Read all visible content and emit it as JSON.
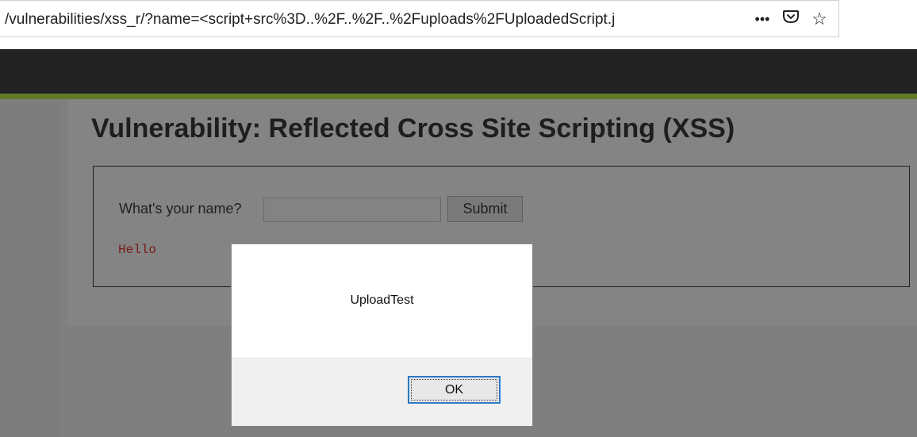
{
  "browser": {
    "url": "/vulnerabilities/xss_r/?name=<script+src%3D..%2F..%2F..%2Fuploads%2FUploadedScript.j",
    "more_icon": "•••",
    "pocket_icon": "Ἅ",
    "bookmark_icon": "☆"
  },
  "page": {
    "title": "Vulnerability: Reflected Cross Site Scripting (XSS)",
    "form": {
      "label": "What's your name?",
      "input_value": "",
      "submit_label": "Submit"
    },
    "output": "Hello"
  },
  "dialog": {
    "message": "UploadTest",
    "ok_label": "OK"
  },
  "colors": {
    "accent_green": "#5f7a29",
    "header_dark": "#222222",
    "focus_blue": "#2b79c6"
  }
}
